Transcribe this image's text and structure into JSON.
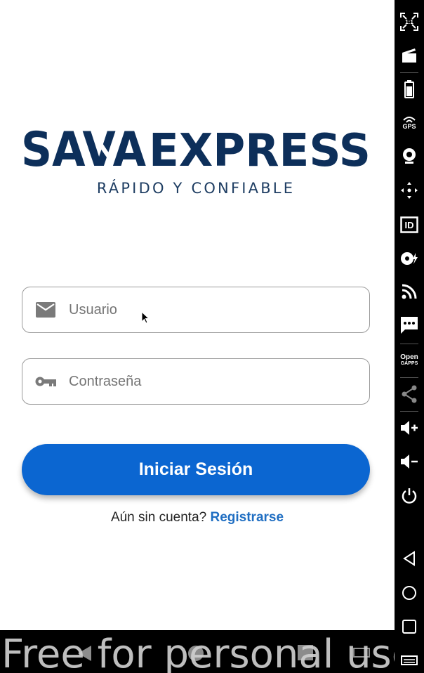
{
  "brand": {
    "name_part1": "SAVA",
    "name_part2": "EXPRESS",
    "tagline": "RÁPIDO Y CONFIABLE",
    "color": "#0d2f5a"
  },
  "login_form": {
    "username_placeholder": "Usuario",
    "password_placeholder": "Contraseña",
    "login_button": "Iniciar Sesión",
    "register_prompt": "Aún sin cuenta?",
    "register_link": "Registrarse"
  },
  "navbar": {
    "watermark": "Free for personal use"
  },
  "sidebar": {
    "icons": [
      "fullscreen-1to1-icon",
      "clapperboard-icon",
      "battery-icon",
      "gps-icon",
      "webcam-icon",
      "move-icon",
      "id-icon",
      "disk-icon",
      "rss-icon",
      "sms-icon",
      "opengapps-icon",
      "share-icon",
      "volume-up-icon",
      "volume-down-icon",
      "power-icon",
      "back-icon",
      "home-icon",
      "recents-icon",
      "menu-icon"
    ],
    "labels": {
      "ratio": "1:1",
      "gps": "GPS",
      "id": "ID",
      "open": "Open",
      "gapps": "GAPPS"
    }
  },
  "colors": {
    "accent": "#0b66d1",
    "link": "#1f6ec2",
    "field_border": "#9a9a9a",
    "placeholder": "#757575"
  }
}
